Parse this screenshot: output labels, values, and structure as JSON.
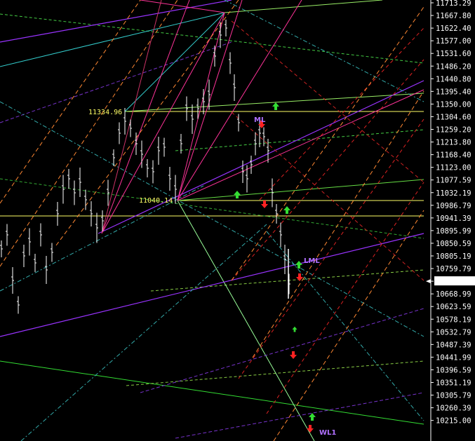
{
  "chart_data": {
    "type": "candlestick",
    "title": "",
    "y_axis": {
      "ticks": [
        "11713.29",
        "11667.80",
        "11622.40",
        "11577.00",
        "11531.60",
        "11486.20",
        "11440.80",
        "11395.40",
        "11350.00",
        "11304.60",
        "11259.20",
        "11213.80",
        "11168.40",
        "11123.00",
        "11077.59",
        "11032.19",
        "10986.79",
        "10941.39",
        "10895.99",
        "10850.59",
        "10805.19",
        "10759.79",
        "10706.14",
        "10668.99",
        "10623.59",
        "10578.19",
        "10532.79",
        "10487.39",
        "10441.99",
        "10396.59",
        "10351.19",
        "10305.79",
        "10260.39",
        "10215.00"
      ],
      "current_price": "10706.14",
      "ylim": [
        10215.0,
        11713.29
      ]
    },
    "price_labels": [
      "11334.96",
      "11040.14"
    ],
    "annotations": [
      "ML",
      "LML",
      "WL1"
    ],
    "colors": {
      "background": "#000000",
      "bars": "#ffffff",
      "yellow": "#ffff66",
      "green": "#33dd33",
      "red": "#ff2222",
      "purple": "#9933ff",
      "cyan": "#33cccc",
      "magenta": "#ff3399",
      "orange": "#ff8833"
    }
  }
}
